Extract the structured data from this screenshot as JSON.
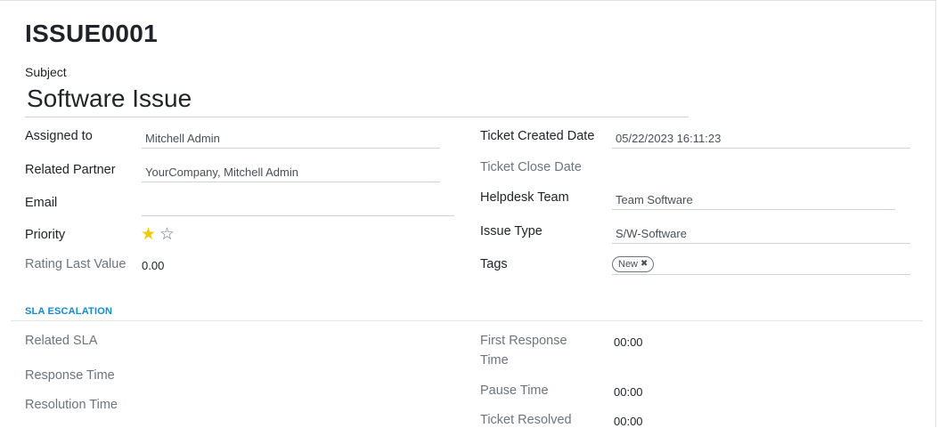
{
  "record": {
    "reference": "ISSUE0001",
    "subject_label": "Subject",
    "subject_value": "Software Issue"
  },
  "left_fields": {
    "assigned_to": {
      "label": "Assigned to",
      "value": "Mitchell Admin"
    },
    "related_partner": {
      "label": "Related Partner",
      "value": "YourCompany, Mitchell Admin"
    },
    "email": {
      "label": "Email",
      "value": ""
    },
    "priority": {
      "label": "Priority",
      "value": 1,
      "max": 2
    },
    "rating_last_value": {
      "label": "Rating Last Value",
      "value": "0.00"
    }
  },
  "right_fields": {
    "ticket_created_date": {
      "label": "Ticket Created Date",
      "value": "05/22/2023 16:11:23"
    },
    "ticket_close_date": {
      "label": "Ticket Close Date",
      "value": ""
    },
    "helpdesk_team": {
      "label": "Helpdesk Team",
      "value": "Team Software"
    },
    "issue_type": {
      "label": "Issue Type",
      "value": "S/W-Software"
    },
    "tags": {
      "label": "Tags",
      "items": [
        "New"
      ]
    }
  },
  "sla": {
    "section_title": "SLA ESCALATION",
    "related_sla": {
      "label": "Related SLA",
      "value": ""
    },
    "response_time": {
      "label": "Response Time",
      "value": ""
    },
    "resolution_time": {
      "label": "Resolution Time",
      "value": ""
    },
    "first_response_time": {
      "label_line1": "First Response",
      "label_line2": "Time",
      "value": "00:00"
    },
    "pause_time": {
      "label": "Pause Time",
      "value": "00:00"
    },
    "ticket_resolved": {
      "label": "Ticket Resolved",
      "value": "00:00"
    }
  },
  "icons": {
    "star_filled": "★",
    "star_empty": "☆",
    "remove_tag": "✖"
  },
  "colors": {
    "star": "#f3cc00",
    "section_title": "#0e8ae0",
    "tag_border": "#6c757d"
  }
}
